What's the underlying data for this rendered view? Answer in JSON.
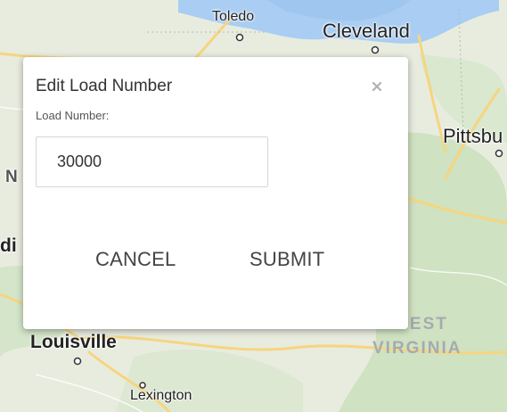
{
  "map": {
    "cities": [
      {
        "id": "toledo",
        "label": "Toledo"
      },
      {
        "id": "cleveland",
        "label": "Cleveland"
      },
      {
        "id": "pittsburgh",
        "label": "Pittsbu"
      },
      {
        "id": "louisville",
        "label": "Louisville"
      },
      {
        "id": "lexington",
        "label": "Lexington"
      },
      {
        "id": "indiana-fragment",
        "label": "di"
      },
      {
        "id": "n-fragment",
        "label": "N"
      }
    ],
    "states": [
      {
        "id": "west-virginia-line1",
        "label": "WEST"
      },
      {
        "id": "west-virginia-line2",
        "label": "VIRGINIA"
      }
    ]
  },
  "dialog": {
    "title": "Edit Load Number",
    "field_label": "Load Number:",
    "load_number_value": "30000",
    "cancel_label": "CANCEL",
    "submit_label": "SUBMIT",
    "close_icon": "close-icon"
  }
}
